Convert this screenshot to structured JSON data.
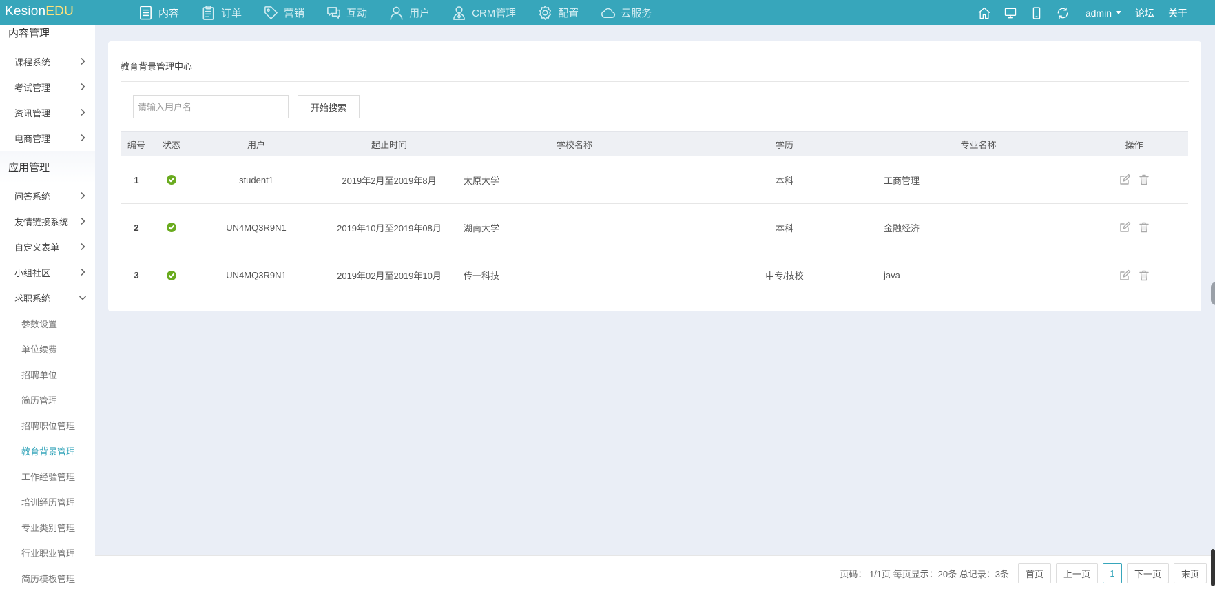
{
  "app": {
    "logo_part1": "Kesion",
    "logo_part2": "EDU"
  },
  "nav": [
    {
      "label": "内容",
      "icon": "document-list-icon",
      "active": true
    },
    {
      "label": "订单",
      "icon": "clipboard-icon",
      "active": false
    },
    {
      "label": "营销",
      "icon": "tag-icon",
      "active": false
    },
    {
      "label": "互动",
      "icon": "chat-icon",
      "active": false
    },
    {
      "label": "用户",
      "icon": "user-icon",
      "active": false
    },
    {
      "label": "CRM管理",
      "icon": "crm-user-icon",
      "active": false
    },
    {
      "label": "配置",
      "icon": "gear-icon",
      "active": false
    },
    {
      "label": "云服务",
      "icon": "cloud-icon",
      "active": false
    }
  ],
  "topright": {
    "user": "admin",
    "forum": "论坛",
    "about": "关于"
  },
  "sidebar": {
    "group_content": "内容管理",
    "content_items": [
      "课程系统",
      "考试管理",
      "资讯管理",
      "电商管理"
    ],
    "group_apps": "应用管理",
    "app_items": [
      "问答系统",
      "友情链接系统",
      "自定义表单",
      "小组社区",
      "求职系统"
    ],
    "job_subitems": [
      "参数设置",
      "单位续费",
      "招聘单位",
      "简历管理",
      "招聘职位管理",
      "教育背景管理",
      "工作经验管理",
      "培训经历管理",
      "专业类别管理",
      "行业职业管理",
      "简历模板管理"
    ],
    "active_subitem": "教育背景管理"
  },
  "page": {
    "title": "教育背景管理中心",
    "search_placeholder": "请输入用户名",
    "search_button": "开始搜索"
  },
  "table": {
    "headers": {
      "id": "编号",
      "status": "状态",
      "user": "用户",
      "time": "起止时间",
      "school": "学校名称",
      "degree": "学历",
      "major": "专业名称",
      "ops": "操作"
    },
    "rows": [
      {
        "id": "1",
        "user": "student1",
        "time": "2019年2月至2019年8月",
        "school": "太原大学",
        "degree": "本科",
        "major": "工商管理"
      },
      {
        "id": "2",
        "user": "UN4MQ3R9N1",
        "time": "2019年10月至2019年08月",
        "school": "湖南大学",
        "degree": "本科",
        "major": "金融经济"
      },
      {
        "id": "3",
        "user": "UN4MQ3R9N1",
        "time": "2019年02月至2019年10月",
        "school": "传一科技",
        "degree": "中专/技校",
        "major": "java"
      }
    ]
  },
  "pager": {
    "info": "页码： 1/1页 每页显示：20条 总记录：3条",
    "first": "首页",
    "prev": "上一页",
    "current": "1",
    "next": "下一页",
    "last": "末页"
  }
}
